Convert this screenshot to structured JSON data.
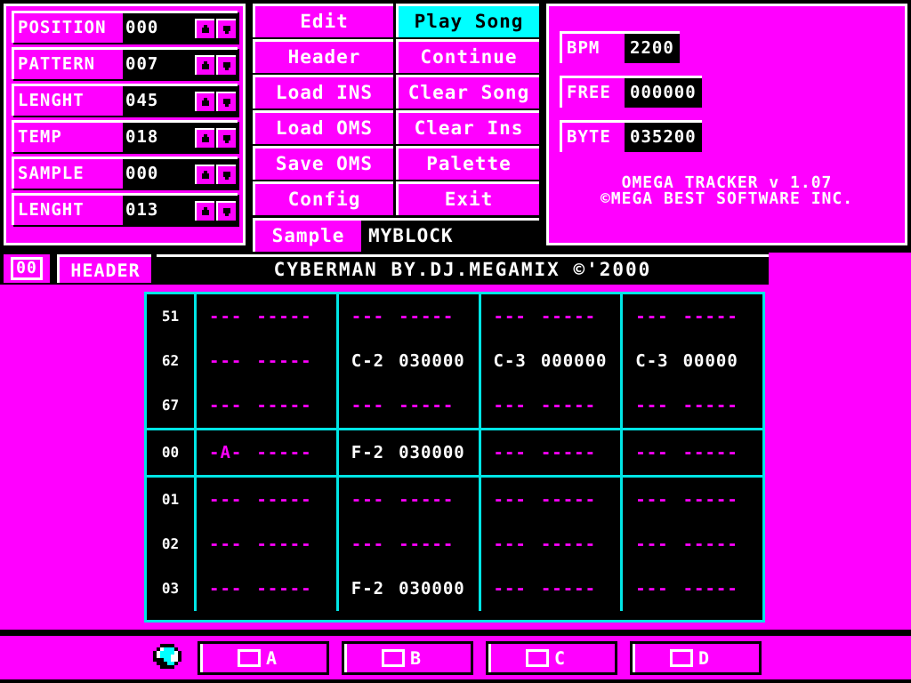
{
  "app": {
    "brand_line1": "OMEGA TRACKER v 1.07",
    "brand_line2": "©MEGA BEST SOFTWARE INC."
  },
  "stats": {
    "rows": [
      {
        "label": "POSITION",
        "value": "000"
      },
      {
        "label": "PATTERN",
        "value": "007"
      },
      {
        "label": "LENGHT",
        "value": "045"
      },
      {
        "label": "TEMP",
        "value": "018"
      },
      {
        "label": "SAMPLE",
        "value": "000"
      },
      {
        "label": "LENGHT",
        "value": "013"
      }
    ]
  },
  "menu": {
    "buttons": [
      {
        "label": "Edit",
        "active": false
      },
      {
        "label": "Play Song",
        "active": true
      },
      {
        "label": "Header",
        "active": false
      },
      {
        "label": "Continue",
        "active": false
      },
      {
        "label": "Load INS",
        "active": false
      },
      {
        "label": "Clear Song",
        "active": false
      },
      {
        "label": "Load OMS",
        "active": false
      },
      {
        "label": "Clear Ins",
        "active": false
      },
      {
        "label": "Save OMS",
        "active": false
      },
      {
        "label": "Palette",
        "active": false
      },
      {
        "label": "Config",
        "active": false
      },
      {
        "label": "Exit",
        "active": false
      }
    ],
    "sample_tab": "Sample",
    "sample_name": "MYBLOCK"
  },
  "info": {
    "bpm_label": "BPM",
    "bpm_value": "2200",
    "free_label": "FREE",
    "free_value": "000000",
    "byte_label": "BYTE",
    "byte_value": "035200"
  },
  "titlebar": {
    "position_tab": "00",
    "header_tab": "HEADER",
    "song_title": "CYBERMAN BY.DJ.MEGAMIX ©'2000"
  },
  "pattern": {
    "blocks": [
      {
        "rows": [
          {
            "num": "51",
            "cells": [
              {
                "note": "---",
                "data": "-----"
              },
              {
                "note": "---",
                "data": "-----"
              },
              {
                "note": "---",
                "data": "-----"
              },
              {
                "note": "---",
                "data": "-----"
              }
            ]
          },
          {
            "num": "62",
            "cells": [
              {
                "note": "---",
                "data": "-----"
              },
              {
                "note": "C-2",
                "data": "030000"
              },
              {
                "note": "C-3",
                "data": "000000"
              },
              {
                "note": "C-3",
                "data": "00000"
              }
            ]
          },
          {
            "num": "67",
            "cells": [
              {
                "note": "---",
                "data": "-----"
              },
              {
                "note": "---",
                "data": "-----"
              },
              {
                "note": "---",
                "data": "-----"
              },
              {
                "note": "---",
                "data": "-----"
              }
            ]
          }
        ]
      },
      {
        "rows": [
          {
            "num": "00",
            "cells": [
              {
                "note": "-A-",
                "data": "-----"
              },
              {
                "note": "F-2",
                "data": "030000"
              },
              {
                "note": "---",
                "data": "-----"
              },
              {
                "note": "---",
                "data": "-----"
              }
            ]
          }
        ]
      },
      {
        "rows": [
          {
            "num": "01",
            "cells": [
              {
                "note": "---",
                "data": "-----"
              },
              {
                "note": "---",
                "data": "-----"
              },
              {
                "note": "---",
                "data": "-----"
              },
              {
                "note": "---",
                "data": "-----"
              }
            ]
          },
          {
            "num": "02",
            "cells": [
              {
                "note": "---",
                "data": "-----"
              },
              {
                "note": "---",
                "data": "-----"
              },
              {
                "note": "---",
                "data": "-----"
              },
              {
                "note": "---",
                "data": "-----"
              }
            ]
          },
          {
            "num": "03",
            "cells": [
              {
                "note": "---",
                "data": "-----"
              },
              {
                "note": "F-2",
                "data": "030000"
              },
              {
                "note": "---",
                "data": "-----"
              },
              {
                "note": "---",
                "data": "-----"
              }
            ]
          }
        ]
      }
    ]
  },
  "bottom": {
    "channels": [
      {
        "label": "A"
      },
      {
        "label": "B"
      },
      {
        "label": "C"
      },
      {
        "label": "D"
      }
    ]
  },
  "colors": {
    "magenta": "#ff00ff",
    "black": "#000000",
    "white": "#ffffff",
    "cyan": "#00e5e5",
    "cyan_bright": "#00ffff"
  }
}
